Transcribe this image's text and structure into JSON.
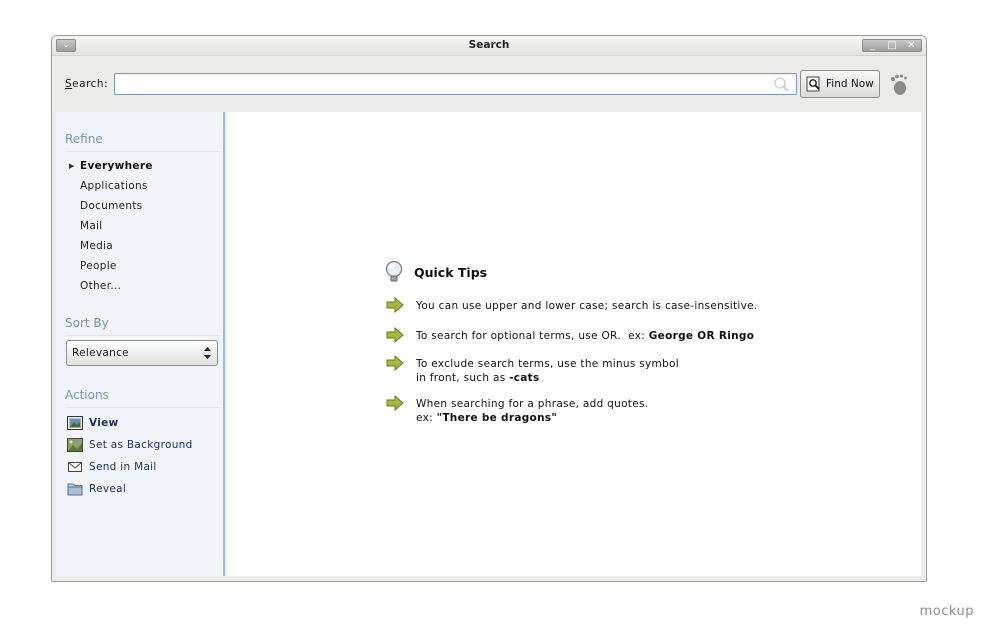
{
  "window": {
    "title": "Search",
    "controls": {
      "minimize": "_",
      "maximize": "□",
      "close": "✕"
    },
    "menu_glyph": "⌄"
  },
  "search": {
    "label_mnemonic": "S",
    "label_rest": "earch:",
    "value": "",
    "placeholder": "",
    "find_button_label": "Find Now"
  },
  "sidebar": {
    "refine": {
      "title": "Refine",
      "items": [
        {
          "label": "Everywhere",
          "selected": true
        },
        {
          "label": "Applications"
        },
        {
          "label": "Documents"
        },
        {
          "label": "Mail"
        },
        {
          "label": "Media"
        },
        {
          "label": "People"
        },
        {
          "label": "Other..."
        }
      ]
    },
    "sort": {
      "title": "Sort By",
      "selected": "Relevance"
    },
    "actions": {
      "title": "Actions",
      "items": [
        {
          "label": "View",
          "icon": "image-view-icon"
        },
        {
          "label": "Set as Background",
          "icon": "wallpaper-icon"
        },
        {
          "label": "Send in Mail",
          "icon": "envelope-icon"
        },
        {
          "label": "Reveal",
          "icon": "folder-icon"
        }
      ]
    }
  },
  "tips": {
    "title": "Quick Tips",
    "items": [
      {
        "pre": "You can use upper and lower case; search is case-insensitive.",
        "bold": ""
      },
      {
        "pre": "To search for optional terms, use OR.  ex: ",
        "bold": "George OR Ringo"
      },
      {
        "pre": "To exclude search terms, use the minus symbol",
        "pre2": "in front, such as ",
        "bold": "-cats"
      },
      {
        "pre": "When searching for a phrase, add quotes.",
        "pre2": "ex: ",
        "bold": "\"There be dragons\""
      }
    ]
  },
  "footer_label": "mockup"
}
